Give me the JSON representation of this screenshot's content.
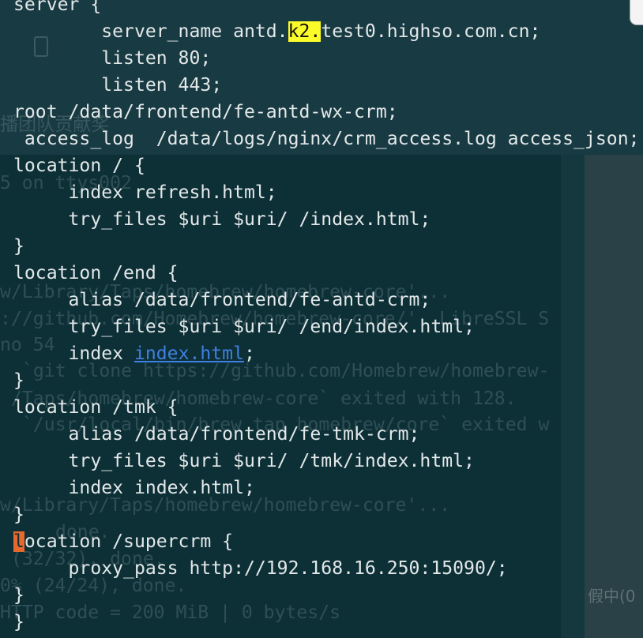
{
  "editor": {
    "lines": [
      {
        "text": "server {"
      },
      {
        "pre": "        server_name antd.",
        "match": "k2.",
        "post": "test0.highso.com.cn;"
      },
      {
        "text": "        listen 80;"
      },
      {
        "text": "        listen 443;"
      },
      {
        "text": "root /data/frontend/fe-antd-wx-crm;"
      },
      {
        "text": " access_log  /data/logs/nginx/crm_access.log access_json;"
      },
      {
        "text": "location / {"
      },
      {
        "text": "     index refresh.html;"
      },
      {
        "text": "     try_files $uri $uri/ /index.html;"
      },
      {
        "text": "}"
      },
      {
        "text": "location /end {"
      },
      {
        "text": "     alias /data/frontend/fe-antd-crm;"
      },
      {
        "text": "     try_files $uri $uri/ /end/index.html;"
      },
      {
        "pre": "     index ",
        "link": "index.html",
        "post": ";"
      },
      {
        "text": "}"
      },
      {
        "text": "location /tmk {"
      },
      {
        "text": "     alias /data/frontend/fe-tmk-crm;"
      },
      {
        "text": "     try_files $uri $uri/ /tmk/index.html;"
      },
      {
        "text": "     index index.html;"
      },
      {
        "text": "}"
      },
      {
        "cursor": "l",
        "post": "ocation /supercrm {"
      },
      {
        "text": "     proxy_pass http://192.168.16.250:15090/;"
      },
      {
        "text": "}"
      },
      {
        "text": "}"
      }
    ]
  },
  "background_windows": {
    "lines": [
      "播团队贡献奖",
      "5 on ttys002",
      "w/Library/Taps/homebrew/homebrew-core'...",
      "://github.com/Homebrew/homebrew-core/'. LibreSSL S",
      "no 54",
      "`git clone https://github.com/Homebrew/homebrew-",
      "/Taps/homebrew/homebrew-core` exited with 128.",
      "`/usr/local/bin/brew tap homebrew/core` exited w",
      "w/Library/Taps/homebrew/homebrew-core'...",
      "done.",
      "(32/32), done.",
      "0% (24/24), done.",
      "HTTP code = 200 MiB | 0 bytes/s"
    ],
    "side_text": "假中(0",
    "icon": "document-icon"
  },
  "colors": {
    "terminal_background": "#0d3037",
    "text": "#e3e8e9",
    "search_match": "#fbfb2a",
    "link": "#3f7fe0",
    "cursor": "#e8682e"
  }
}
